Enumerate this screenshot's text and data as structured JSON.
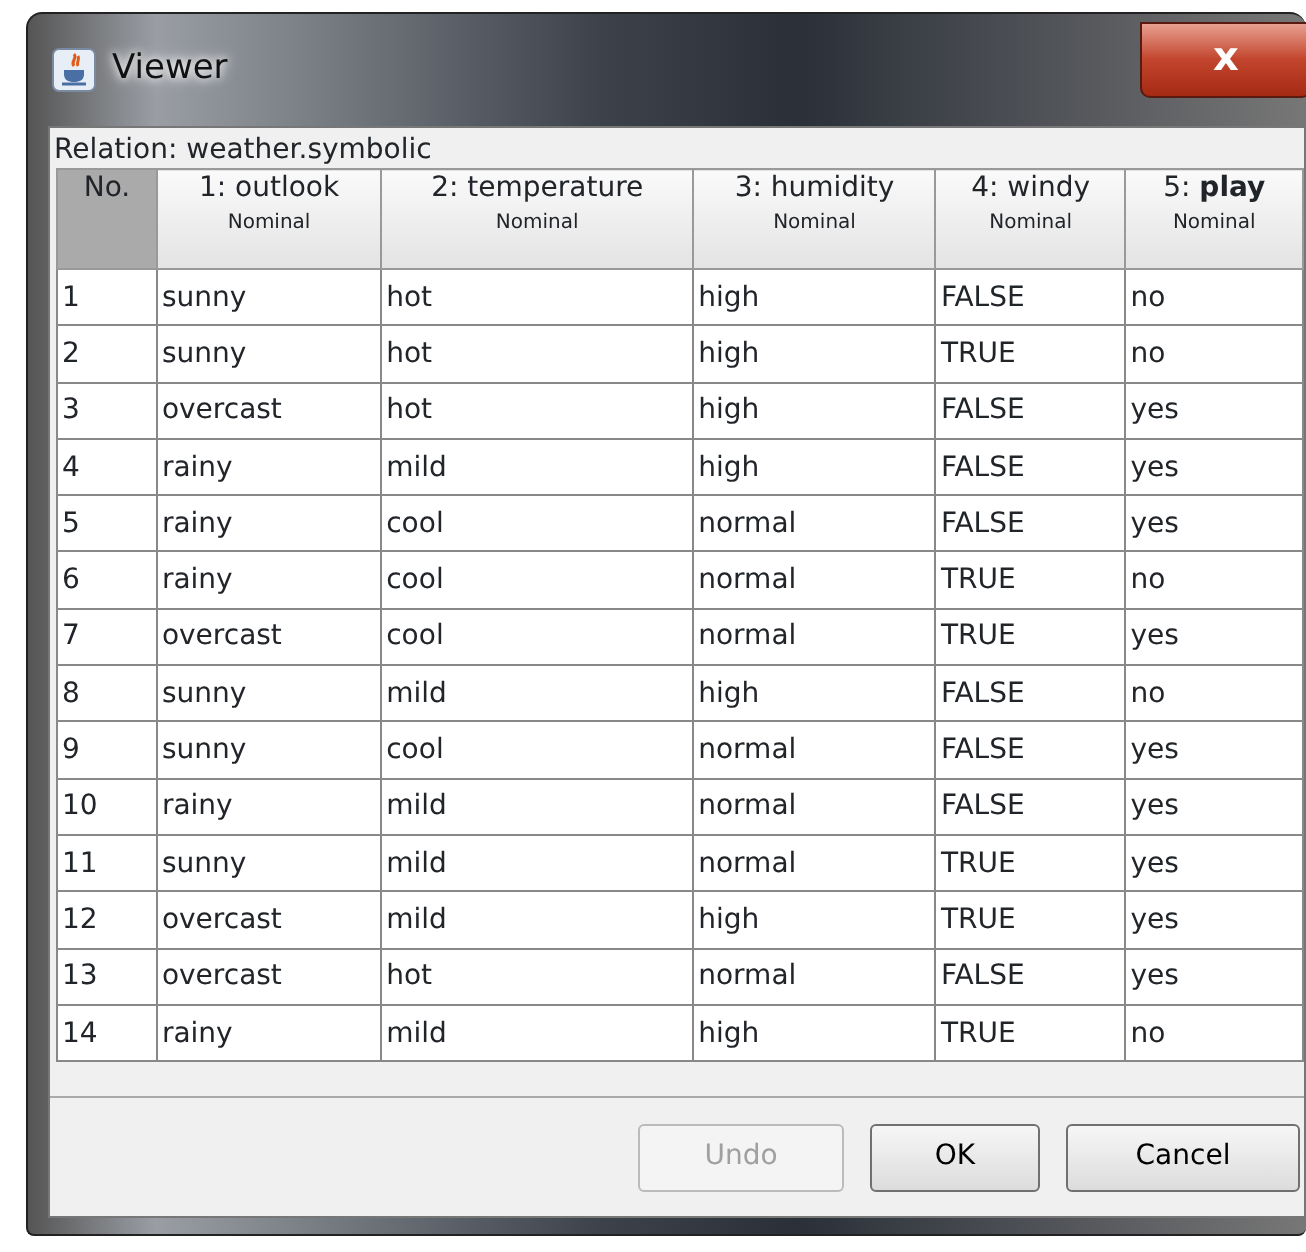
{
  "window": {
    "title": "Viewer",
    "close": "x"
  },
  "relation": "Relation: weather.symbolic",
  "table": {
    "columns": [
      {
        "name": "No.",
        "selected": true
      },
      {
        "name": "1: outlook",
        "type": "Nominal",
        "selected": false
      },
      {
        "name": "2: temperature",
        "type": "Nominal",
        "selected": false
      },
      {
        "name": "3: humidity",
        "type": "Nominal",
        "selected": false
      },
      {
        "name": "4: windy",
        "type": "Nominal",
        "selected": false
      },
      {
        "name": "5: **play**",
        "type": "Nominal",
        "selected": false
      }
    ],
    "rows": [
      [
        "1",
        "sunny",
        "hot",
        "high",
        "FALSE",
        "no"
      ],
      [
        "2",
        "sunny",
        "hot",
        "high",
        "TRUE",
        "no"
      ],
      [
        "3",
        "overcast",
        "hot",
        "high",
        "FALSE",
        "yes"
      ],
      [
        "4",
        "rainy",
        "mild",
        "high",
        "FALSE",
        "yes"
      ],
      [
        "5",
        "rainy",
        "cool",
        "normal",
        "FALSE",
        "yes"
      ],
      [
        "6",
        "rainy",
        "cool",
        "normal",
        "TRUE",
        "no"
      ],
      [
        "7",
        "overcast",
        "cool",
        "normal",
        "TRUE",
        "yes"
      ],
      [
        "8",
        "sunny",
        "mild",
        "high",
        "FALSE",
        "no"
      ],
      [
        "9",
        "sunny",
        "cool",
        "normal",
        "FALSE",
        "yes"
      ],
      [
        "10",
        "rainy",
        "mild",
        "normal",
        "FALSE",
        "yes"
      ],
      [
        "11",
        "sunny",
        "mild",
        "normal",
        "TRUE",
        "yes"
      ],
      [
        "12",
        "overcast",
        "mild",
        "high",
        "TRUE",
        "yes"
      ],
      [
        "13",
        "overcast",
        "hot",
        "normal",
        "FALSE",
        "yes"
      ],
      [
        "14",
        "rainy",
        "mild",
        "high",
        "TRUE",
        "no"
      ]
    ]
  },
  "buttons": [
    {
      "label": "Undo",
      "disabled": true
    },
    {
      "label": "OK",
      "disabled": false
    },
    {
      "label": "Cancel",
      "disabled": false
    }
  ]
}
